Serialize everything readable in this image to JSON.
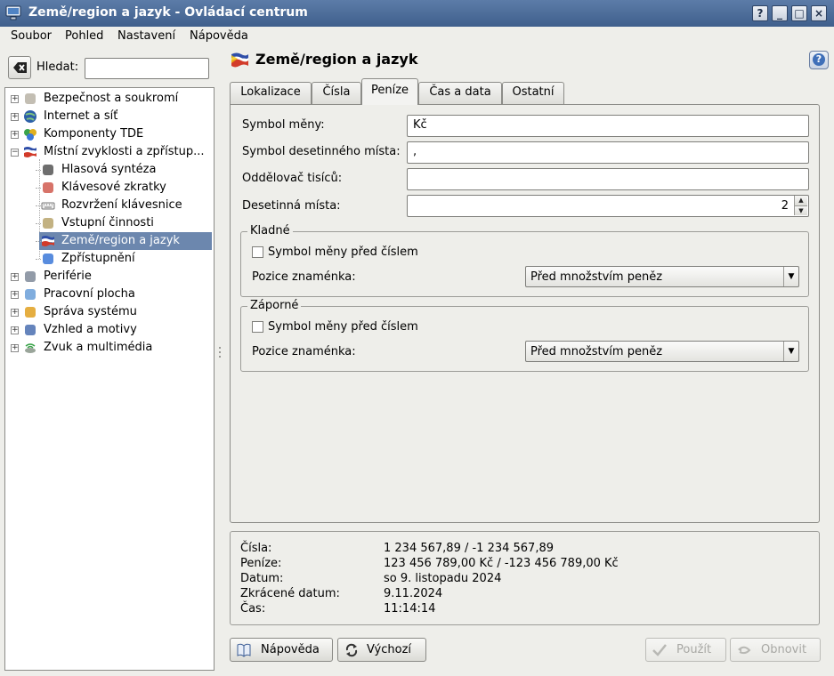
{
  "window": {
    "title": "Země/region a jazyk - Ovládací centrum",
    "buttons": [
      "?",
      "_",
      "□",
      "×"
    ]
  },
  "menu": [
    "Soubor",
    "Pohled",
    "Nastavení",
    "Nápověda"
  ],
  "search": {
    "label": "Hledat:",
    "value": ""
  },
  "tree": [
    {
      "label": "Bezpečnost a soukromí",
      "icon": "security-icon",
      "expander": "+"
    },
    {
      "label": "Internet a síť",
      "icon": "globe-icon",
      "expander": "+"
    },
    {
      "label": "Komponenty TDE",
      "icon": "components-icon",
      "expander": "+"
    },
    {
      "label": "Místní zvyklosti a zpřístup...",
      "icon": "flag-icon",
      "expander": "−"
    },
    {
      "label": "Hlasová syntéza",
      "icon": "speech-icon",
      "child": true
    },
    {
      "label": "Klávesové zkratky",
      "icon": "shortcuts-icon",
      "child": true
    },
    {
      "label": "Rozvržení klávesnice",
      "icon": "keyboard-icon",
      "child": true
    },
    {
      "label": "Vstupní činnosti",
      "icon": "input-actions-icon",
      "child": true
    },
    {
      "label": "Země/region a jazyk",
      "icon": "flag-icon",
      "child": true,
      "selected": true
    },
    {
      "label": "Zpřístupnění",
      "icon": "accessibility-icon",
      "child": true
    },
    {
      "label": "Periférie",
      "icon": "peripherals-icon",
      "expander": "+"
    },
    {
      "label": "Pracovní plocha",
      "icon": "desktop-icon",
      "expander": "+"
    },
    {
      "label": "Správa systému",
      "icon": "system-admin-icon",
      "expander": "+"
    },
    {
      "label": "Vzhled a motivy",
      "icon": "appearance-icon",
      "expander": "+"
    },
    {
      "label": "Zvuk a multimédia",
      "icon": "sound-icon",
      "expander": "+"
    }
  ],
  "module": {
    "title": "Země/region a jazyk"
  },
  "tabs": [
    "Lokalizace",
    "Čísla",
    "Peníze",
    "Čas a data",
    "Ostatní"
  ],
  "active_tab": "Peníze",
  "money": {
    "currency_symbol_label": "Symbol měny:",
    "currency_symbol": "Kč",
    "decimal_symbol_label": "Symbol desetinného místa:",
    "decimal_symbol": ",",
    "thousands_sep_label": "Oddělovač tisíců:",
    "thousands_sep": "",
    "decimal_places_label": "Desetinná místa:",
    "decimal_places": "2",
    "positive": {
      "title": "Kladné",
      "symbol_before_label": "Symbol měny před číslem",
      "sign_position_label": "Pozice znaménka:",
      "sign_position": "Před množstvím peněz"
    },
    "negative": {
      "title": "Záporné",
      "symbol_before_label": "Symbol měny před číslem",
      "sign_position_label": "Pozice znaménka:",
      "sign_position": "Před množstvím peněz"
    }
  },
  "preview": {
    "rows": [
      {
        "label": "Čísla:",
        "value": "1 234 567,89 / -1 234 567,89"
      },
      {
        "label": "Peníze:",
        "value": "123 456 789,00 Kč / -123 456 789,00 Kč"
      },
      {
        "label": "Datum:",
        "value": "so 9. listopadu 2024"
      },
      {
        "label": "Zkrácené datum:",
        "value": "9.11.2024"
      },
      {
        "label": "Čas:",
        "value": "11:14:14"
      }
    ]
  },
  "buttons": {
    "help": "Nápověda",
    "defaults": "Výchozí",
    "apply": "Použít",
    "reset": "Obnovit"
  }
}
